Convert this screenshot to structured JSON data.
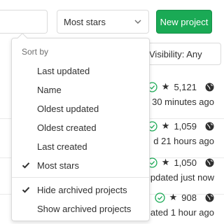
{
  "toolbar": {
    "filter_placeholder": "",
    "sort_select_label": "Most stars",
    "new_project_label": "New project",
    "new_project_color": "#1aaa55"
  },
  "visibility": {
    "label": "Visibility: Any"
  },
  "sort_menu": {
    "header": "Sort by",
    "sort_options": [
      {
        "label": "Last updated",
        "active": false
      },
      {
        "label": "Name",
        "active": false
      },
      {
        "label": "Oldest updated",
        "active": false
      },
      {
        "label": "Oldest created",
        "active": false
      },
      {
        "label": "Last created",
        "active": false
      },
      {
        "label": "Most stars",
        "active": true
      }
    ],
    "archive_options": [
      {
        "label": "Hide archived projects",
        "active": true
      },
      {
        "label": "Show archived projects",
        "active": false
      }
    ]
  },
  "projects": [
    {
      "stars": "5,121",
      "updated": "d 30 minutes ago",
      "ci_status": "passed"
    },
    {
      "stars": "1,059",
      "updated": "d 21 hours ago",
      "ci_status": "passed"
    },
    {
      "stars": "1,050",
      "updated": "updated just now",
      "ci_status": "passed"
    },
    {
      "stars": "908",
      "updated": "odated 1 hour ago",
      "ci_status": "passed"
    }
  ],
  "colors": {
    "ci_passed": "#1aaa55",
    "border": "#dbdbdb",
    "text": "#303030",
    "muted": "#707070"
  },
  "icons": {
    "select_caret": "chevron-down-icon",
    "check": "check-icon",
    "ci": "status-success-icon",
    "star": "star-icon",
    "visibility": "globe-icon"
  }
}
